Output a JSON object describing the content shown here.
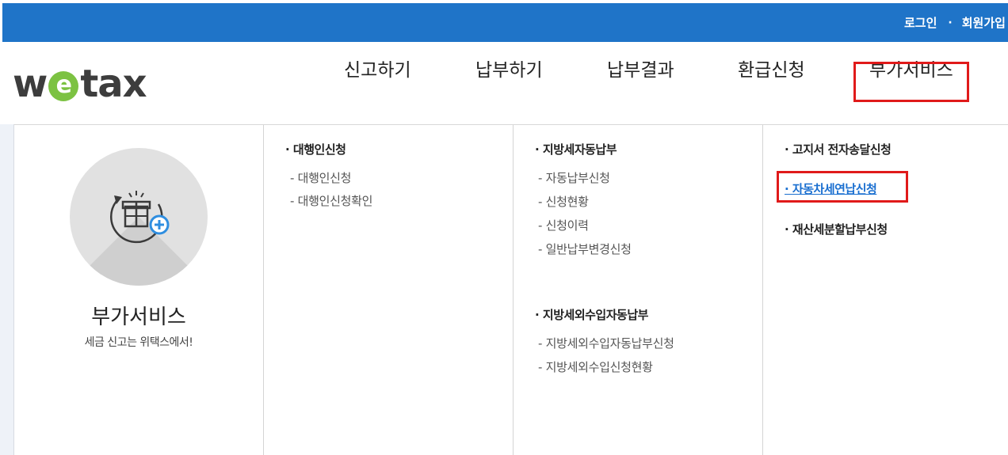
{
  "top_util": {
    "login": "로그인",
    "separator": "·",
    "signup": "회원가입"
  },
  "logo": {
    "prefix": "w",
    "e_letter": "e",
    "suffix": "tax"
  },
  "gnb": [
    {
      "label": "신고하기"
    },
    {
      "label": "납부하기"
    },
    {
      "label": "납부결과"
    },
    {
      "label": "환급신청"
    },
    {
      "label": "부가서비스",
      "highlighted": true
    }
  ],
  "service": {
    "title": "부가서비스",
    "subtitle": "세금 신고는 위택스에서!",
    "icon": "gift-box-icon"
  },
  "col1": {
    "title": "· 대행인신청",
    "items": [
      "- 대행인신청",
      "- 대행인신청확인"
    ]
  },
  "col2": {
    "sections": [
      {
        "title": "· 지방세자동납부",
        "items": [
          "- 자동납부신청",
          "- 신청현황",
          "- 신청이력",
          "- 일반납부변경신청"
        ]
      },
      {
        "title": "· 지방세외수입자동납부",
        "items": [
          "- 지방세외수입자동납부신청",
          "- 지방세외수입신청현황"
        ]
      }
    ]
  },
  "col3": {
    "items": [
      {
        "label": "· 고지서 전자송달신청"
      },
      {
        "label": "· 자동차세연납신청",
        "active": true
      },
      {
        "label": "· 재산세분할납부신청"
      }
    ]
  },
  "colors": {
    "topbar": "#1f74c8",
    "highlight_box": "#e01a1a",
    "link": "#1a6fd0",
    "logo_e": "#7cc242"
  }
}
